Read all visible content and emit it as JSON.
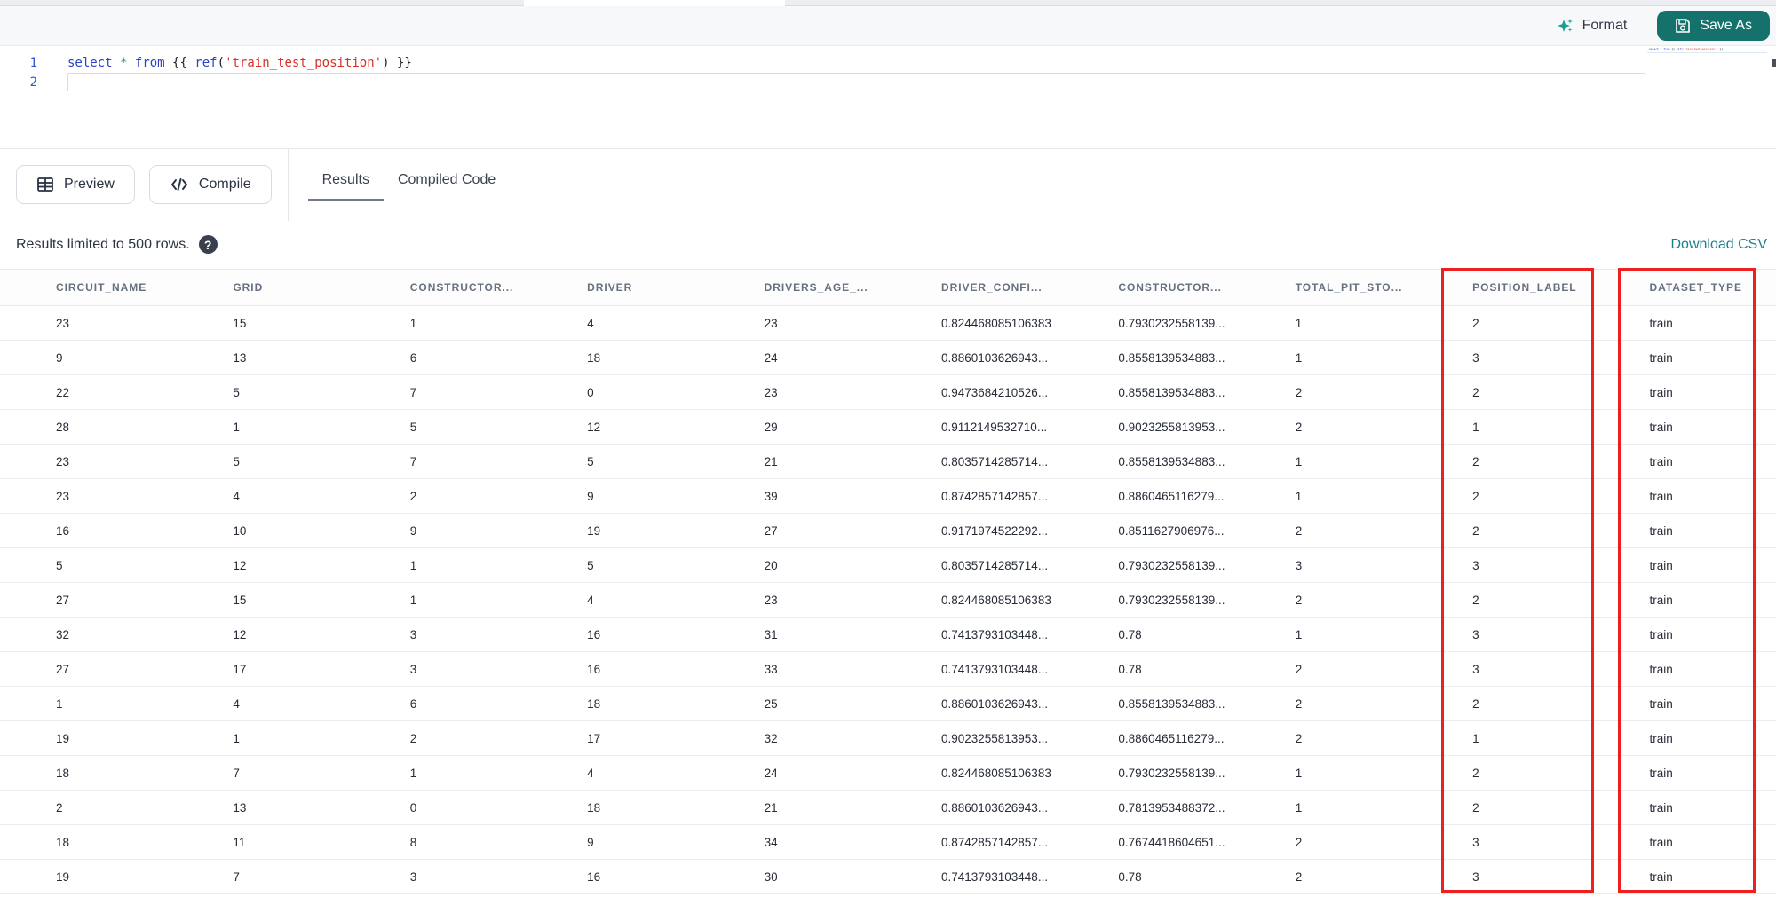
{
  "toolbar": {
    "format_label": "Format",
    "save_as_label": "Save As"
  },
  "editor": {
    "line_numbers": [
      "1",
      "2"
    ],
    "code_tokens": [
      {
        "text": "select",
        "type": "keyword"
      },
      {
        "text": " ",
        "type": "plain"
      },
      {
        "text": "*",
        "type": "operator"
      },
      {
        "text": " ",
        "type": "plain"
      },
      {
        "text": "from",
        "type": "keyword"
      },
      {
        "text": " {{ ",
        "type": "plain"
      },
      {
        "text": "ref",
        "type": "keyword"
      },
      {
        "text": "(",
        "type": "plain"
      },
      {
        "text": "'train_test_position'",
        "type": "string"
      },
      {
        "text": ")",
        "type": "plain"
      },
      {
        "text": " }}",
        "type": "plain"
      }
    ],
    "active_line": "2"
  },
  "actions": {
    "preview_label": "Preview",
    "compile_label": "Compile"
  },
  "tabs": {
    "results_label": "Results",
    "compiled_label": "Compiled Code",
    "active_tab": "Results"
  },
  "results_bar": {
    "limit_text": "Results limited to 500 rows.",
    "help_icon": "question-mark-circle",
    "download_label": "Download CSV"
  },
  "table": {
    "columns": [
      "CIRCUIT_NAME",
      "GRID",
      "CONSTRUCTOR...",
      "DRIVER",
      "DRIVERS_AGE_...",
      "DRIVER_CONFI...",
      "CONSTRUCTOR...",
      "TOTAL_PIT_STO...",
      "POSITION_LABEL",
      "DATASET_TYPE"
    ],
    "rows": [
      [
        "23",
        "15",
        "1",
        "4",
        "23",
        "0.824468085106383",
        "0.7930232558139...",
        "1",
        "2",
        "train"
      ],
      [
        "9",
        "13",
        "6",
        "18",
        "24",
        "0.8860103626943...",
        "0.8558139534883...",
        "1",
        "3",
        "train"
      ],
      [
        "22",
        "5",
        "7",
        "0",
        "23",
        "0.9473684210526...",
        "0.8558139534883...",
        "2",
        "2",
        "train"
      ],
      [
        "28",
        "1",
        "5",
        "12",
        "29",
        "0.9112149532710...",
        "0.9023255813953...",
        "2",
        "1",
        "train"
      ],
      [
        "23",
        "5",
        "7",
        "5",
        "21",
        "0.8035714285714...",
        "0.8558139534883...",
        "1",
        "2",
        "train"
      ],
      [
        "23",
        "4",
        "2",
        "9",
        "39",
        "0.8742857142857...",
        "0.8860465116279...",
        "1",
        "2",
        "train"
      ],
      [
        "16",
        "10",
        "9",
        "19",
        "27",
        "0.9171974522292...",
        "0.8511627906976...",
        "2",
        "2",
        "train"
      ],
      [
        "5",
        "12",
        "1",
        "5",
        "20",
        "0.8035714285714...",
        "0.7930232558139...",
        "3",
        "3",
        "train"
      ],
      [
        "27",
        "15",
        "1",
        "4",
        "23",
        "0.824468085106383",
        "0.7930232558139...",
        "2",
        "2",
        "train"
      ],
      [
        "32",
        "12",
        "3",
        "16",
        "31",
        "0.7413793103448...",
        "0.78",
        "1",
        "3",
        "train"
      ],
      [
        "27",
        "17",
        "3",
        "16",
        "33",
        "0.7413793103448...",
        "0.78",
        "2",
        "3",
        "train"
      ],
      [
        "1",
        "4",
        "6",
        "18",
        "25",
        "0.8860103626943...",
        "0.8558139534883...",
        "2",
        "2",
        "train"
      ],
      [
        "19",
        "1",
        "2",
        "17",
        "32",
        "0.9023255813953...",
        "0.8860465116279...",
        "2",
        "1",
        "train"
      ],
      [
        "18",
        "7",
        "1",
        "4",
        "24",
        "0.824468085106383",
        "0.7930232558139...",
        "1",
        "2",
        "train"
      ],
      [
        "2",
        "13",
        "0",
        "18",
        "21",
        "0.8860103626943...",
        "0.7813953488372...",
        "1",
        "2",
        "train"
      ],
      [
        "18",
        "11",
        "8",
        "9",
        "34",
        "0.8742857142857...",
        "0.7674418604651...",
        "2",
        "3",
        "train"
      ],
      [
        "19",
        "7",
        "3",
        "16",
        "30",
        "0.7413793103448...",
        "0.78",
        "2",
        "3",
        "train"
      ]
    ],
    "highlighted_columns": [
      "POSITION_LABEL",
      "DATASET_TYPE"
    ],
    "highlight_color": "#ee1f1f"
  },
  "colors": {
    "accent_teal": "#15716b",
    "link_teal": "#1b7f8e",
    "keyword_blue": "#2a43c8",
    "string_red": "#d93025",
    "highlight_red": "#ee1f1f",
    "toolbar_bg": "#f7f8fa"
  }
}
